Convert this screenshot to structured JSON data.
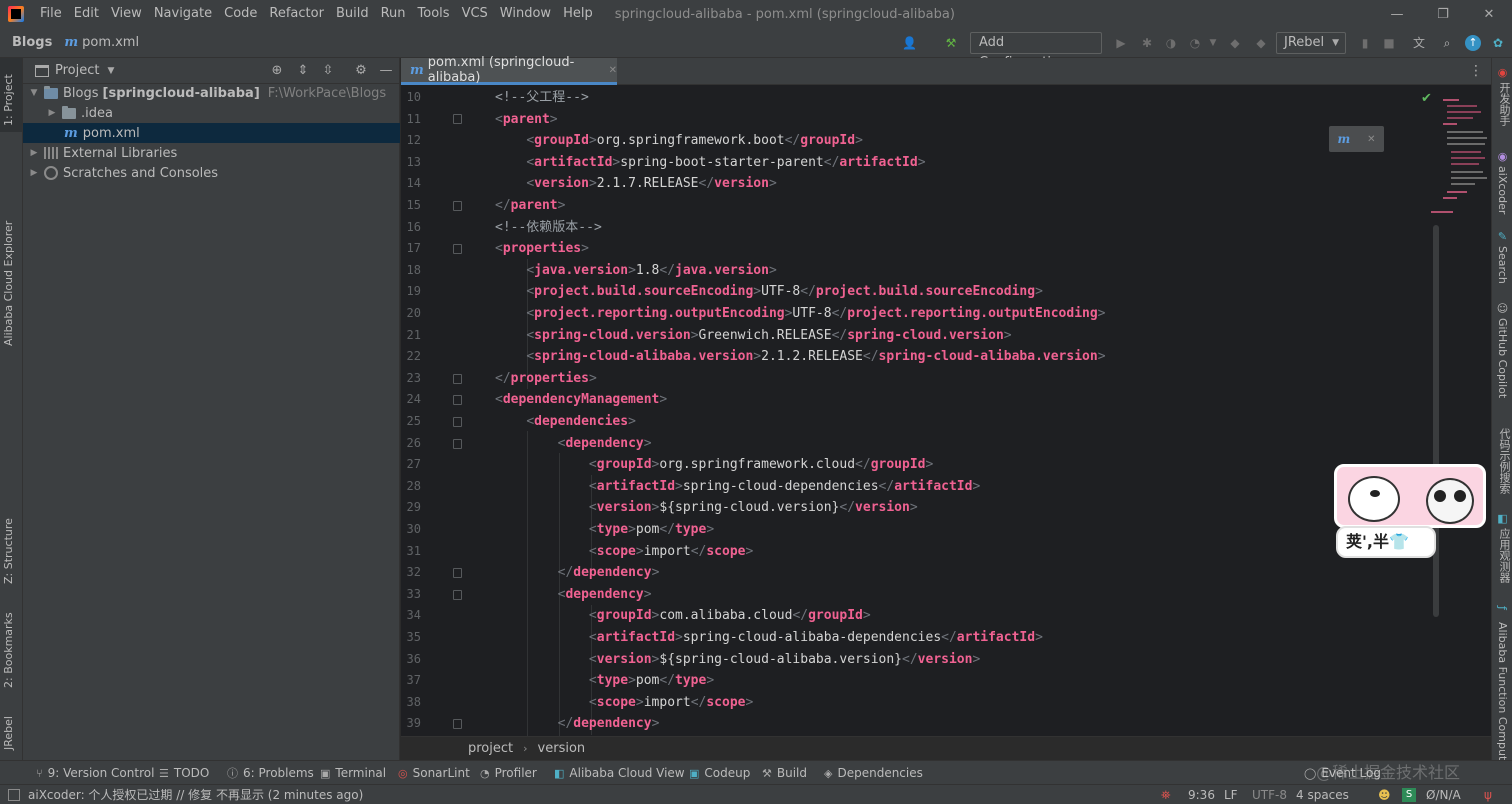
{
  "window": {
    "title": "springcloud-alibaba - pom.xml (springcloud-alibaba)",
    "controls": [
      "—",
      "❐",
      "✕"
    ]
  },
  "menu": [
    "File",
    "Edit",
    "View",
    "Navigate",
    "Code",
    "Refactor",
    "Build",
    "Run",
    "Tools",
    "VCS",
    "Window",
    "Help"
  ],
  "breadcrumb": {
    "project": "Blogs",
    "file": "pom.xml",
    "file_icon": "m"
  },
  "toolbar": {
    "run_config_label": "Add Configuration...",
    "jrebel_label": "JRebel"
  },
  "left_tool_windows": [
    "1: Project",
    "Alibaba Cloud Explorer",
    "Z: Structure",
    "2: Bookmarks",
    "JRebel"
  ],
  "right_tool_windows": [
    "开发助手",
    "aiXcoder",
    "Search",
    "GitHub Copilot",
    "代码示例搜索",
    "应用观测器",
    "Alibaba Function Compute"
  ],
  "project_panel": {
    "title": "Project",
    "tree": [
      {
        "label": "Blogs",
        "bold": "[springcloud-alibaba]",
        "path": "F:\\WorkPace\\Blogs"
      },
      {
        "label": ".idea"
      },
      {
        "label": "pom.xml"
      },
      {
        "label": "External Libraries"
      },
      {
        "label": "Scratches and Consoles"
      }
    ]
  },
  "editor": {
    "tab_label": "pom.xml (springcloud-alibaba)",
    "line_numbers": [
      "10",
      "11",
      "12",
      "13",
      "14",
      "15",
      "16",
      "17",
      "18",
      "19",
      "20",
      "21",
      "22",
      "23",
      "24",
      "25",
      "26",
      "27",
      "28",
      "29",
      "30",
      "31",
      "32",
      "33",
      "34",
      "35",
      "36",
      "37",
      "38",
      "39"
    ],
    "comments": {
      "l10": "<!--父工程-->",
      "l16": "<!--依赖版本-->"
    },
    "tags": {
      "parent": "parent",
      "groupId": "groupId",
      "artifactId": "artifactId",
      "version": "version",
      "properties": "properties",
      "java_version": "java.version",
      "source_encoding": "project.build.sourceEncoding",
      "output_encoding": "project.reporting.outputEncoding",
      "spring_cloud_version": "spring-cloud.version",
      "spring_cloud_alibaba_version": "spring-cloud-alibaba.version",
      "dependencyManagement": "dependencyManagement",
      "dependencies": "dependencies",
      "dependency": "dependency",
      "type": "type",
      "scope": "scope"
    },
    "values": {
      "l12": "org.springframework.boot",
      "l13": "spring-boot-starter-parent",
      "l14": "2.1.7.RELEASE",
      "l18": "1.8",
      "l19": "UTF-8",
      "l20": "UTF-8",
      "l21": "Greenwich.RELEASE",
      "l22": "2.1.2.RELEASE",
      "l27": "org.springframework.cloud",
      "l28": "spring-cloud-dependencies",
      "l29": "${spring-cloud.version}",
      "l30": "pom",
      "l31": "import",
      "l34": "com.alibaba.cloud",
      "l35": "spring-cloud-alibaba-dependencies",
      "l36": "${spring-cloud-alibaba.version}",
      "l37": "pom",
      "l38": "import"
    },
    "sticker_caption": "荚',半👕"
  },
  "code_breadcrumb": {
    "project": "project",
    "version": "version"
  },
  "tool_strip": [
    {
      "label": "9: Version Control",
      "icon": "branch-icon"
    },
    {
      "label": "TODO",
      "icon": "list-icon"
    },
    {
      "label": "6: Problems",
      "icon": "info-icon"
    },
    {
      "label": "Terminal",
      "icon": "terminal-icon"
    },
    {
      "label": "SonarLint",
      "icon": "sonar-icon"
    },
    {
      "label": "Profiler",
      "icon": "profiler-icon"
    },
    {
      "label": "Alibaba Cloud View",
      "icon": "cloud-icon"
    },
    {
      "label": "Codeup",
      "icon": "codeup-icon"
    },
    {
      "label": "Build",
      "icon": "hammer-icon"
    },
    {
      "label": "Dependencies",
      "icon": "layers-icon"
    },
    {
      "label": "Event Log",
      "icon": "log-icon"
    }
  ],
  "status": {
    "message": "aiXcoder: 个人授权已过期 // 修复   不再显示 (2 minutes ago)",
    "cursor": "9:36",
    "line_sep": "LF",
    "encoding": "UTF-8",
    "indent": "4 spaces",
    "readonly": "Ø/N/A"
  },
  "watermark": "@稀土掘金技术社区",
  "colors": {
    "tag": "#f06292",
    "selection": "#0d293e",
    "accent": "#4a88c7"
  }
}
